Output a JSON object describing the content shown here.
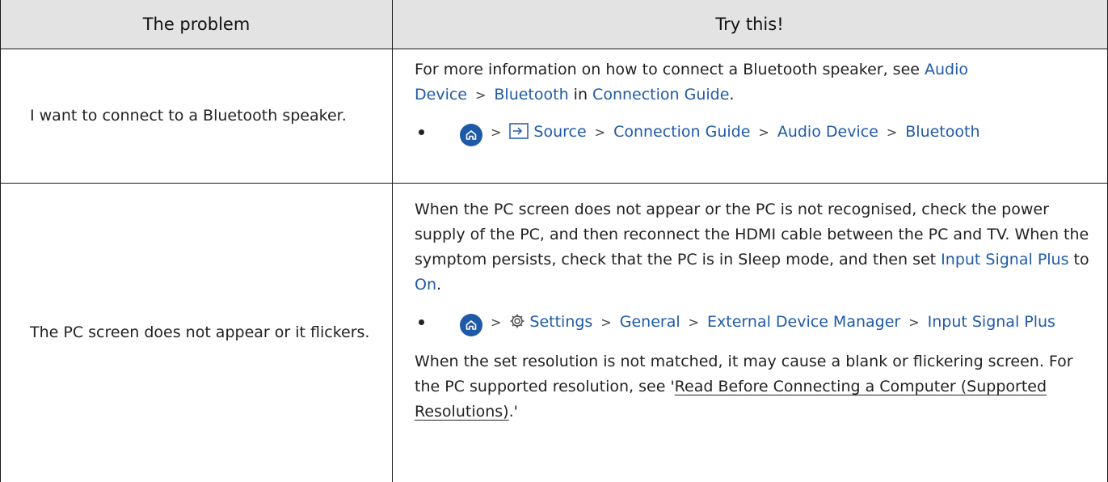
{
  "table": {
    "header": {
      "col1": "The problem",
      "col2": "Try this!"
    },
    "rows": [
      {
        "problem": "I want to connect to a Bluetooth speaker.",
        "info": {
          "t1": "For more information on how to connect a Bluetooth speaker, see ",
          "link1": "Audio Device",
          "sep": ">",
          "link2": "Bluetooth",
          "t2": " in ",
          "link3": "Connection Guide",
          "t3": "."
        },
        "path": [
          "Source",
          "Connection Guide",
          "Audio Device",
          "Bluetooth"
        ]
      },
      {
        "problem": "The PC screen does not appear or it flickers.",
        "p1": {
          "t1": "When the PC screen does not appear or the PC is not recognised, check the power supply of the PC, and then reconnect the HDMI cable between the PC and TV. When the symptom persists, check that the PC is in Sleep mode, and then set ",
          "link1": "Input Signal Plus",
          "t2": " to ",
          "link2": "On",
          "t3": "."
        },
        "path": [
          "Settings",
          "General",
          "External Device Manager",
          "Input Signal Plus"
        ],
        "p2": {
          "t1": "When the set resolution is not matched, it may cause a blank or flickering screen. For the PC supported resolution, see '",
          "link": "Read Before Connecting a Computer (Supported Resolutions)",
          "t2": ".'"
        }
      }
    ]
  },
  "colors": {
    "link": "#1f5aa8",
    "header_bg": "#e3e3e3",
    "border": "#1a1a1a",
    "text": "#222222"
  },
  "icons": [
    "home-icon",
    "source-icon",
    "settings-gear-icon"
  ]
}
